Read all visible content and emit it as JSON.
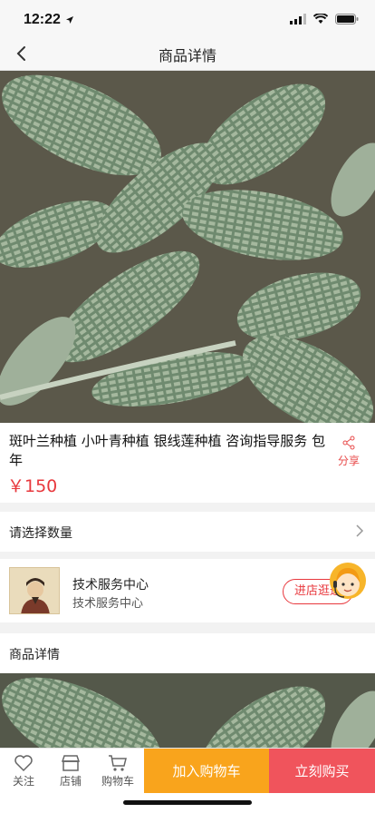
{
  "status_bar": {
    "time": "12:22"
  },
  "nav": {
    "title": "商品详情"
  },
  "product": {
    "title": "斑叶兰种植 小叶青种植 银线莲种植 咨询指导服务 包年",
    "price": "￥150",
    "share_label": "分享"
  },
  "quantity": {
    "label": "请选择数量"
  },
  "shop": {
    "name": "技术服务中心",
    "subtitle": "技术服务中心",
    "enter_label": "进店逛逛"
  },
  "detail": {
    "label": "商品详情"
  },
  "bottom_bar": {
    "follow_label": "关注",
    "shop_label": "店铺",
    "cart_label": "购物车",
    "add_cart_label": "加入购物车",
    "buy_now_label": "立刻购买"
  },
  "colors": {
    "accent_red": "#e8383d",
    "add_cart_orange": "#f9a41c",
    "buy_now_red": "#f0545c"
  }
}
